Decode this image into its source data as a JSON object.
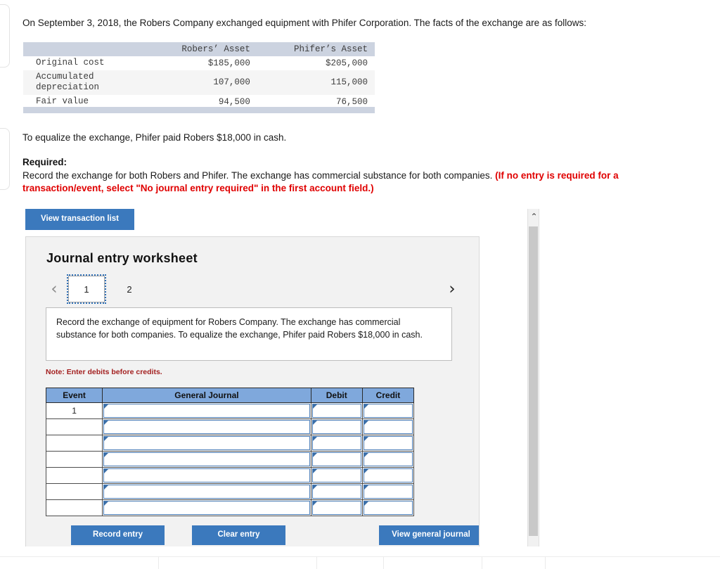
{
  "problem": {
    "intro": "On September 3, 2018, the Robers Company exchanged equipment with Phifer Corporation. The facts of the exchange are as follows:",
    "equalize": "To equalize the exchange, Phifer paid Robers $18,000 in cash.",
    "required_label": "Required:",
    "required_body": "Record the exchange for both Robers and Phifer. The exchange has commercial substance for both companies. ",
    "required_warning": "(If no entry is required for a transaction/event, select \"No journal entry required\" in the first account field.)"
  },
  "facts_table": {
    "blank_header": "",
    "columns": [
      "Robers’ Asset",
      "Phifer’s Asset"
    ],
    "rows": [
      {
        "label": "Original cost",
        "robers": "$185,000",
        "phifer": "$205,000"
      },
      {
        "label": "Accumulated\ndepreciation",
        "robers": "107,000",
        "phifer": "115,000"
      },
      {
        "label": "Fair value",
        "robers": "94,500",
        "phifer": "76,500"
      }
    ]
  },
  "toolbar": {
    "view_transaction_list": "View transaction list"
  },
  "worksheet": {
    "title": "Journal entry worksheet",
    "pager": {
      "prev_icon": "‹",
      "next_icon": "›",
      "tabs": [
        {
          "label": "1",
          "active": true
        },
        {
          "label": "2",
          "active": false
        }
      ]
    },
    "description": "Record the exchange of equipment for Robers Company. The exchange has commercial substance for both companies. To equalize the exchange, Phifer paid Robers $18,000 in cash.",
    "note": "Note: Enter debits before credits.",
    "table": {
      "headers": [
        "Event",
        "General Journal",
        "Debit",
        "Credit"
      ],
      "rows": [
        {
          "event": "1",
          "general_journal": "",
          "debit": "",
          "credit": ""
        },
        {
          "event": "",
          "general_journal": "",
          "debit": "",
          "credit": ""
        },
        {
          "event": "",
          "general_journal": "",
          "debit": "",
          "credit": ""
        },
        {
          "event": "",
          "general_journal": "",
          "debit": "",
          "credit": ""
        },
        {
          "event": "",
          "general_journal": "",
          "debit": "",
          "credit": ""
        },
        {
          "event": "",
          "general_journal": "",
          "debit": "",
          "credit": ""
        },
        {
          "event": "",
          "general_journal": "",
          "debit": "",
          "credit": ""
        }
      ]
    },
    "buttons": {
      "record_entry": "Record entry",
      "clear_entry": "Clear entry",
      "view_general_journal": "View general journal"
    }
  },
  "scrollbar": {
    "up_icon": "⌃"
  },
  "colors": {
    "button_blue": "#3b79bd",
    "table_header_blue": "#7fa8dc",
    "facts_header_bg": "#ccd3e0",
    "warning_red": "#e00000",
    "note_red": "#a32020",
    "cell_border_blue": "#4a7cb5"
  }
}
